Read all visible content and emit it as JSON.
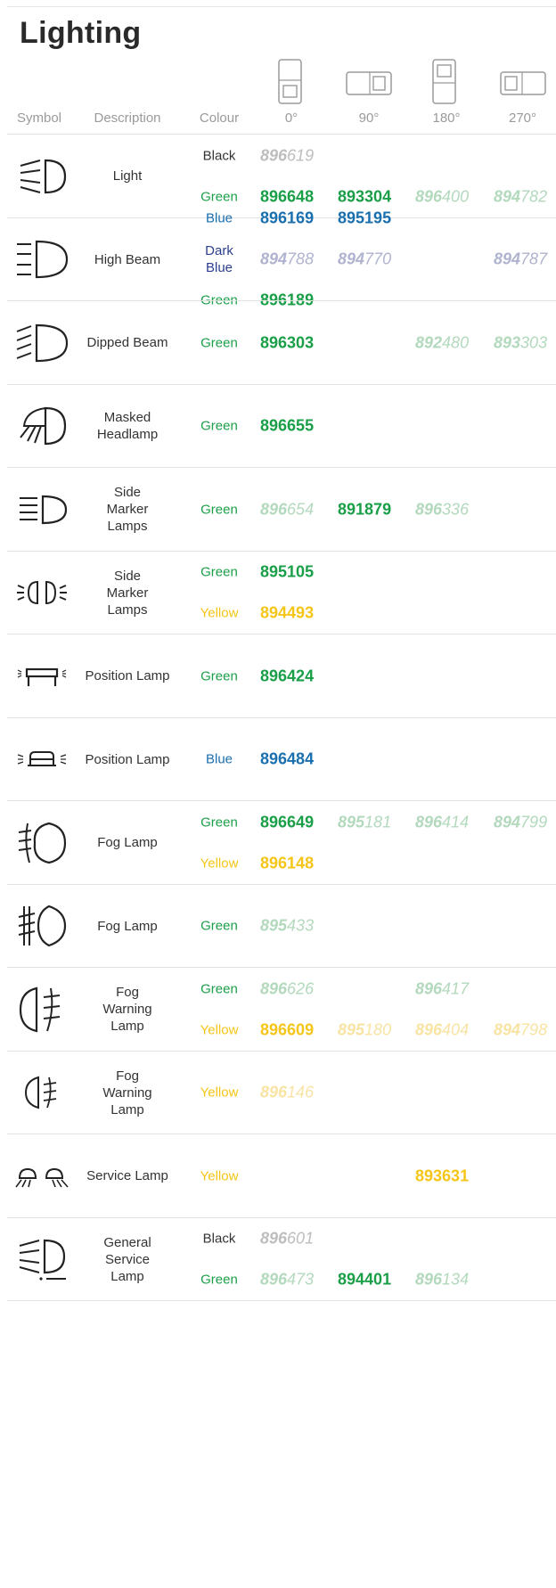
{
  "title": "Lighting",
  "headers": [
    "Symbol",
    "Description",
    "Colour",
    "0°",
    "90°",
    "180°",
    "270°"
  ],
  "colors": {
    "Black": "#333333",
    "Green": "#1a9f48",
    "Blue": "#1a6faf",
    "Dark Blue": "#2b3f8e",
    "Yellow": "#f5c518",
    "light_Black": "#bdbdbd",
    "light_Green": "#b3d9bd",
    "light_Dark Blue": "#b0b3cf",
    "light_Yellow": "#f8e3a2"
  },
  "rows": [
    {
      "icon": "light-icon",
      "description": "Light",
      "lines": [
        {
          "colour": "Black",
          "codes": [
            {
              "prefix": "896",
              "suffix": "619",
              "style": "light"
            },
            null,
            null,
            null
          ]
        },
        {
          "colour": "Green",
          "codes": [
            {
              "prefix": "896",
              "suffix": "648",
              "style": "bold"
            },
            {
              "prefix": "893",
              "suffix": "304",
              "style": "bold"
            },
            {
              "prefix": "896",
              "suffix": "400",
              "style": "light"
            },
            {
              "prefix": "894",
              "suffix": "782",
              "style": "light"
            }
          ]
        }
      ]
    },
    {
      "icon": "high-beam-icon",
      "description": "High Beam",
      "lines": [
        {
          "colour": "Blue",
          "codes": [
            {
              "prefix": "896",
              "suffix": "169",
              "style": "bold"
            },
            {
              "prefix": "895",
              "suffix": "195",
              "style": "bold"
            },
            null,
            null
          ]
        },
        {
          "colour": "Dark Blue",
          "codes": [
            {
              "prefix": "894",
              "suffix": "788",
              "style": "light"
            },
            {
              "prefix": "894",
              "suffix": "770",
              "style": "light"
            },
            null,
            {
              "prefix": "894",
              "suffix": "787",
              "style": "light"
            }
          ]
        },
        {
          "colour": "Green",
          "codes": [
            {
              "prefix": "896",
              "suffix": "189",
              "style": "bold"
            },
            null,
            null,
            null
          ]
        }
      ]
    },
    {
      "icon": "dipped-beam-icon",
      "description": "Dipped Beam",
      "lines": [
        {
          "colour": "Green",
          "codes": [
            {
              "prefix": "896",
              "suffix": "303",
              "style": "bold"
            },
            null,
            {
              "prefix": "892",
              "suffix": "480",
              "style": "light"
            },
            {
              "prefix": "893",
              "suffix": "303",
              "style": "light"
            }
          ]
        }
      ]
    },
    {
      "icon": "masked-headlamp-icon",
      "description": "Masked Headlamp",
      "lines": [
        {
          "colour": "Green",
          "codes": [
            {
              "prefix": "896",
              "suffix": "655",
              "style": "bold"
            },
            null,
            null,
            null
          ]
        }
      ]
    },
    {
      "icon": "side-marker-lamps-icon",
      "description": "Side Marker Lamps",
      "lines": [
        {
          "colour": "Green",
          "codes": [
            {
              "prefix": "896",
              "suffix": "654",
              "style": "light"
            },
            {
              "prefix": "891",
              "suffix": "879",
              "style": "bold"
            },
            {
              "prefix": "896",
              "suffix": "336",
              "style": "light"
            },
            null
          ]
        }
      ]
    },
    {
      "icon": "side-marker-lamps-alt-icon",
      "description": "Side Marker Lamps",
      "lines": [
        {
          "colour": "Green",
          "codes": [
            {
              "prefix": "895",
              "suffix": "105",
              "style": "bold"
            },
            null,
            null,
            null
          ]
        },
        {
          "colour": "Yellow",
          "codes": [
            {
              "prefix": "894",
              "suffix": "493",
              "style": "bold"
            },
            null,
            null,
            null
          ]
        }
      ]
    },
    {
      "icon": "position-lamp-icon",
      "description": "Position Lamp",
      "lines": [
        {
          "colour": "Green",
          "codes": [
            {
              "prefix": "896",
              "suffix": "424",
              "style": "bold"
            },
            null,
            null,
            null
          ]
        }
      ]
    },
    {
      "icon": "position-lamp-alt-icon",
      "description": "Position Lamp",
      "lines": [
        {
          "colour": "Blue",
          "codes": [
            {
              "prefix": "896",
              "suffix": "484",
              "style": "bold"
            },
            null,
            null,
            null
          ]
        }
      ]
    },
    {
      "icon": "fog-lamp-icon",
      "description": "Fog Lamp",
      "lines": [
        {
          "colour": "Green",
          "codes": [
            {
              "prefix": "896",
              "suffix": "649",
              "style": "bold"
            },
            {
              "prefix": "895",
              "suffix": "181",
              "style": "light"
            },
            {
              "prefix": "896",
              "suffix": "414",
              "style": "light"
            },
            {
              "prefix": "894",
              "suffix": "799",
              "style": "light"
            }
          ]
        },
        {
          "colour": "Yellow",
          "codes": [
            {
              "prefix": "896",
              "suffix": "148",
              "style": "bold"
            },
            null,
            null,
            null
          ]
        }
      ]
    },
    {
      "icon": "fog-lamp-alt-icon",
      "description": "Fog Lamp",
      "lines": [
        {
          "colour": "Green",
          "codes": [
            {
              "prefix": "895",
              "suffix": "433",
              "style": "light"
            },
            null,
            null,
            null
          ]
        }
      ]
    },
    {
      "icon": "fog-warning-lamp-icon",
      "description": "Fog Warning Lamp",
      "lines": [
        {
          "colour": "Green",
          "codes": [
            {
              "prefix": "896",
              "suffix": "626",
              "style": "light"
            },
            null,
            {
              "prefix": "896",
              "suffix": "417",
              "style": "light"
            },
            null
          ]
        },
        {
          "colour": "Yellow",
          "codes": [
            {
              "prefix": "896",
              "suffix": "609",
              "style": "bold"
            },
            {
              "prefix": "895",
              "suffix": "180",
              "style": "light"
            },
            {
              "prefix": "896",
              "suffix": "404",
              "style": "light"
            },
            {
              "prefix": "894",
              "suffix": "798",
              "style": "light"
            }
          ]
        }
      ]
    },
    {
      "icon": "fog-warning-lamp-alt-icon",
      "description": "Fog Warning Lamp",
      "lines": [
        {
          "colour": "Yellow",
          "codes": [
            {
              "prefix": "896",
              "suffix": "146",
              "style": "light"
            },
            null,
            null,
            null
          ]
        }
      ]
    },
    {
      "icon": "service-lamp-icon",
      "description": "Service Lamp",
      "lines": [
        {
          "colour": "Yellow",
          "codes": [
            null,
            null,
            {
              "prefix": "893",
              "suffix": "631",
              "style": "bold"
            },
            null
          ]
        }
      ]
    },
    {
      "icon": "general-service-lamp-icon",
      "description": "General Service Lamp",
      "lines": [
        {
          "colour": "Black",
          "codes": [
            {
              "prefix": "896",
              "suffix": "601",
              "style": "light"
            },
            null,
            null,
            null
          ]
        },
        {
          "colour": "Green",
          "codes": [
            {
              "prefix": "896",
              "suffix": "473",
              "style": "light"
            },
            {
              "prefix": "894",
              "suffix": "401",
              "style": "bold"
            },
            {
              "prefix": "896",
              "suffix": "134",
              "style": "light"
            },
            null
          ]
        }
      ]
    }
  ]
}
